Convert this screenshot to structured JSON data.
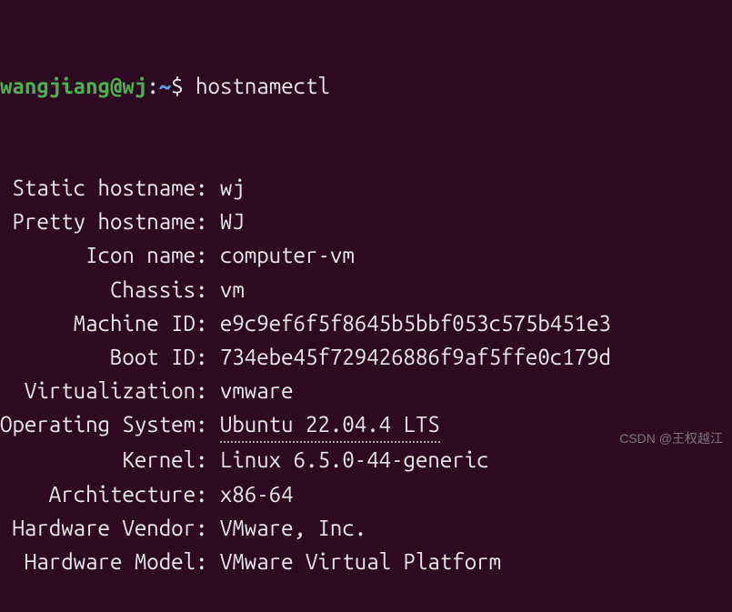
{
  "prompt": {
    "user": "wangjiang",
    "host": "wj",
    "at": "@",
    "colon": ":",
    "path": "~",
    "dollar": "$ "
  },
  "command": "hostnamectl",
  "rows": [
    {
      "key": " Static hostname: ",
      "value": "wj",
      "underline": false
    },
    {
      "key": " Pretty hostname: ",
      "value": "WJ",
      "underline": false
    },
    {
      "key": "       Icon name: ",
      "value": "computer-vm",
      "underline": false
    },
    {
      "key": "         Chassis: ",
      "value": "vm",
      "underline": false
    },
    {
      "key": "      Machine ID: ",
      "value": "e9c9ef6f5f8645b5bbf053c575b451e3",
      "underline": false
    },
    {
      "key": "         Boot ID: ",
      "value": "734ebe45f729426886f9af5ffe0c179d",
      "underline": false
    },
    {
      "key": "  Virtualization: ",
      "value": "vmware",
      "underline": false
    },
    {
      "key": "Operating System: ",
      "value": "Ubuntu 22.04.4 LTS",
      "underline": true
    },
    {
      "key": "          Kernel: ",
      "value": "Linux 6.5.0-44-generic",
      "underline": false
    },
    {
      "key": "    Architecture: ",
      "value": "x86-64",
      "underline": false
    },
    {
      "key": " Hardware Vendor: ",
      "value": "VMware, Inc.",
      "underline": false
    },
    {
      "key": "  Hardware Model: ",
      "value": "VMware Virtual Platform",
      "underline": false
    }
  ],
  "watermark": "CSDN @王权越江"
}
